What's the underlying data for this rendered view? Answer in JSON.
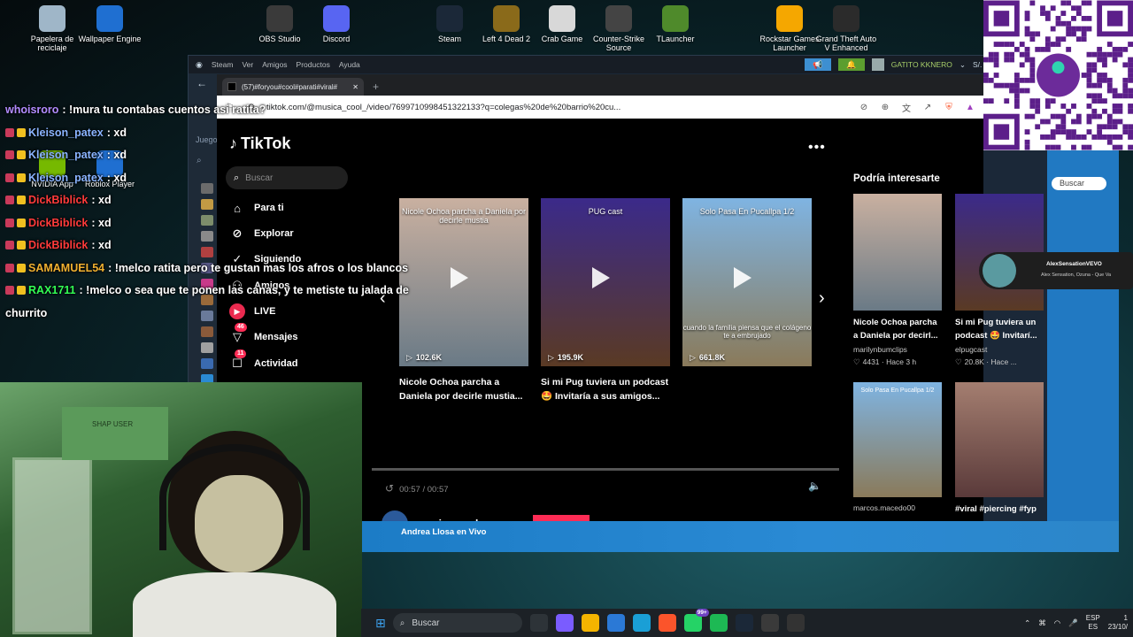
{
  "desktop_icons": [
    {
      "label": "Papelera de reciclaje",
      "icon": "recycle-bin-icon",
      "color": "#9fb6c8"
    },
    {
      "label": "Wallpaper Engine",
      "icon": "wallpaper-engine-icon",
      "color": "#1f6fd1"
    },
    {
      "label": "OBS Studio",
      "icon": "obs-icon",
      "color": "#3a3a3a"
    },
    {
      "label": "Discord",
      "icon": "discord-icon",
      "color": "#5865f2"
    },
    {
      "label": "Steam",
      "icon": "steam-icon",
      "color": "#1b2838"
    },
    {
      "label": "Left 4 Dead 2",
      "icon": "left4dead2-icon",
      "color": "#8a6a1a"
    },
    {
      "label": "Crab Game",
      "icon": "crab-game-icon",
      "color": "#d8d8d8"
    },
    {
      "label": "Counter-Strike Source",
      "icon": "counter-strike-icon",
      "color": "#444444"
    },
    {
      "label": "TLauncher",
      "icon": "tlauncher-icon",
      "color": "#4f8a2b"
    },
    {
      "label": "Rockstar Games Launcher",
      "icon": "rockstar-icon",
      "color": "#f5a700"
    },
    {
      "label": "Grand Theft Auto V Enhanced",
      "icon": "gta-icon",
      "color": "#2b2b2b"
    },
    {
      "label": "NVIDIA App",
      "icon": "nvidia-icon",
      "color": "#76b900"
    },
    {
      "label": "Roblox Player",
      "icon": "roblox-icon",
      "color": "#1f6fd1"
    }
  ],
  "steam": {
    "brand": "Steam",
    "menu": [
      "Ver",
      "Amigos",
      "Productos",
      "Ayuda"
    ],
    "user": "GATITO KKNERO",
    "balance": "S/. 15.00",
    "library_label": "Juego",
    "store_search": "Buscar"
  },
  "browser": {
    "tab_title": "(57)#foryou#cool#parati#viral#",
    "url": "tiktok.com/@musica_cool_/video/7?q=colegas%20de%20barrio%20cu...",
    "url_full": "tiktok.com/@musica_cool_/video/7699710998451322133?q=colegas%20de%20barrio%20cu..."
  },
  "tiktok": {
    "logo": "TikTok",
    "search_placeholder": "Buscar",
    "nav": [
      {
        "label": "Para ti",
        "icon": "home-icon"
      },
      {
        "label": "Explorar",
        "icon": "compass-icon"
      },
      {
        "label": "Siguiendo",
        "icon": "following-icon"
      },
      {
        "label": "Amigos",
        "icon": "friends-icon"
      },
      {
        "label": "LIVE",
        "icon": "live-icon"
      },
      {
        "label": "Mensajes",
        "icon": "messages-icon",
        "badge": "46"
      },
      {
        "label": "Actividad",
        "icon": "activity-icon",
        "badge": "11"
      }
    ],
    "videos": [
      {
        "title": "Nicole Ochoa parcha a Daniela por decirle mustia...",
        "views": "102.6K",
        "overlay": "Nicole Ochoa parcha a Daniela por decirle mustia",
        "color_top": "#c9b0a0",
        "color_bottom": "#6a7a86"
      },
      {
        "title": "Si mi Pug tuviera un podcast 🤩 Invitaría a sus amigos...",
        "views": "195.9K",
        "overlay": "PUG cast",
        "color_top": "#3b2a8a",
        "color_bottom": "#5a3a24"
      },
      {
        "title": "",
        "views": "661.8K",
        "overlay": "Solo Pasa En Pucallpa 1/2",
        "caption": "cuando la familia piensa que el colágeno te a embrujado",
        "color_top": "#7fb4e2",
        "color_bottom": "#8a7a5a"
      }
    ],
    "player": {
      "time": "00:57 / 00:57",
      "progress": 1.0,
      "author": "musica cool"
    },
    "recommended_title": "Podría interesarte",
    "recommended": [
      {
        "title": "Nicole Ochoa parcha a Daniela por decirl...",
        "author": "marilynbumclips",
        "likes": "4431",
        "age": "Hace 3 h",
        "color_top": "#c9b0a0",
        "color_bottom": "#6a7a86"
      },
      {
        "title": "Si mi Pug tuviera un podcast 🤩 Invitarí...",
        "author": "elpugcast",
        "likes": "20.8K",
        "age": "Hace ...",
        "color_top": "#3b2a8a",
        "color_bottom": "#5a3a24"
      },
      {
        "title": "",
        "author": "marcos.macedo00",
        "likes": "",
        "age": "",
        "overlay": "Solo Pasa En Pucallpa 1/2",
        "color_top": "#7fb4e2",
        "color_bottom": "#8a7a5a"
      },
      {
        "title": "#viral #piercing #fyp",
        "author": "",
        "likes": "",
        "age": "",
        "color_top": "#a47e70",
        "color_bottom": "#5a3a3a"
      }
    ],
    "mini_player": {
      "title": "AlexSensationVEVO",
      "subtitle": "Alex Sensation, Ozuna - Que Va"
    }
  },
  "chat": [
    {
      "user": "whoisroro",
      "msg": ": !mura tu contabas cuentos asi ratita?",
      "color": "#b28cff"
    },
    {
      "user": "Kleison_patex",
      "msg": ": xd",
      "color": "#8ab4ff"
    },
    {
      "user": "Kleison_patex",
      "msg": ": xd",
      "color": "#8ab4ff"
    },
    {
      "user": "Kleison_patex",
      "msg": ": xd",
      "color": "#8ab4ff"
    },
    {
      "user": "DickBiblick",
      "msg": ": xd",
      "color": "#ff3b3b"
    },
    {
      "user": "DickBiblick",
      "msg": ": xd",
      "color": "#ff3b3b"
    },
    {
      "user": "DickBiblick",
      "msg": ": xd",
      "color": "#ff3b3b"
    },
    {
      "user": "SAMAMUEL54",
      "msg": ": !melco ratita pero te gustan mas los afros o los blancos",
      "color": "#f0b030"
    },
    {
      "user": "RAX1711",
      "msg": ": !melco o sea que te ponen las canas, y te metiste tu jalada de",
      "color": "#33ff55"
    },
    {
      "user": "",
      "msg": "churrito",
      "color": "#ffffff"
    }
  ],
  "webcam": {
    "poster_text": "SHAP USER"
  },
  "now_playing": {
    "text": "Andrea Llosa en Vivo"
  },
  "taskbar": {
    "search": "Buscar",
    "apps": [
      {
        "icon": "task-view-icon",
        "color": "#2d3338"
      },
      {
        "icon": "copilot-icon",
        "color": "#7a5cff"
      },
      {
        "icon": "file-explorer-icon",
        "color": "#f4b400"
      },
      {
        "icon": "store-icon",
        "color": "#2b79d6"
      },
      {
        "icon": "edge-icon",
        "color": "#1a9fd6"
      },
      {
        "icon": "brave-icon",
        "color": "#fb542b"
      },
      {
        "icon": "whatsapp-icon",
        "color": "#25d366",
        "badge": "99+"
      },
      {
        "icon": "spotify-icon",
        "color": "#1db954"
      },
      {
        "icon": "steam-taskbar-icon",
        "color": "#1b2838"
      },
      {
        "icon": "obs-taskbar-icon",
        "color": "#3a3a3a"
      },
      {
        "icon": "xbox-icon",
        "color": "#333333"
      }
    ],
    "lang_top": "ESP",
    "lang_bottom": "ES",
    "time": "1",
    "date": "23/10/"
  }
}
